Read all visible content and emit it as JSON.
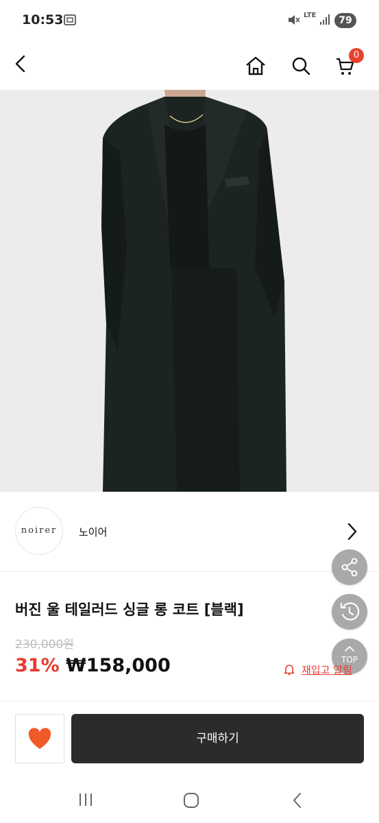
{
  "status_bar": {
    "time": "10:53",
    "network": "LTE",
    "battery": "79"
  },
  "header": {
    "cart_count": "0",
    "icons": [
      "back-icon",
      "home-icon",
      "search-icon",
      "cart-icon"
    ]
  },
  "seller": {
    "logo_text": "noirer",
    "name": "노이어"
  },
  "product": {
    "title": "버진 울 테일러드 싱글 롱 코트 [블랙]",
    "original_price": "230,000원",
    "discount": "31%",
    "price": "₩158,000"
  },
  "restock": {
    "label": "재입고 알림"
  },
  "fabs": {
    "top_label": "TOP"
  },
  "actions": {
    "buy_label": "구매하기"
  },
  "colors": {
    "accent": "#e63b2f",
    "badge": "#e8412c",
    "buy_button": "#2b2b2b",
    "fab": "#a9a9a9"
  }
}
